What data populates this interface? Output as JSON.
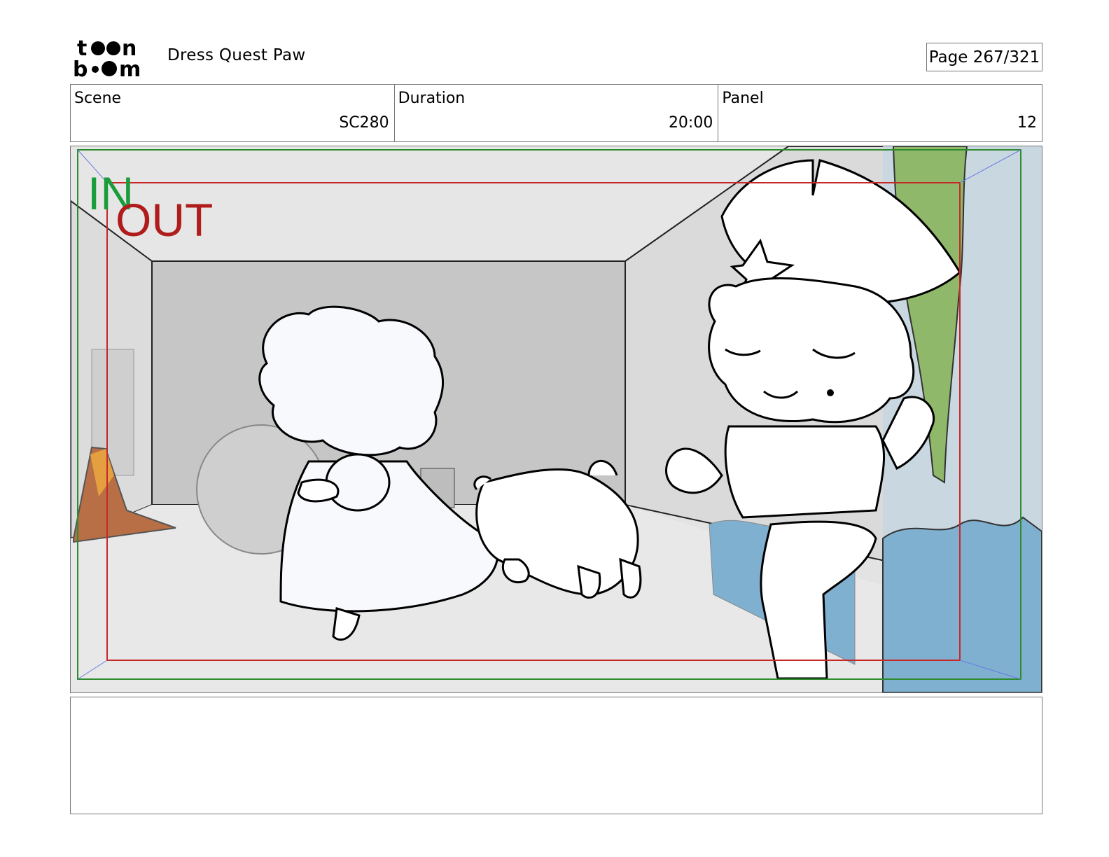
{
  "header": {
    "logo_text": "toon boom",
    "project_title": "Dress Quest Paw",
    "page_label": "Page 267/321"
  },
  "info": {
    "scene_label": "Scene",
    "scene_value": "SC280",
    "duration_label": "Duration",
    "duration_value": "20:00",
    "panel_label": "Panel",
    "panel_value": "12"
  },
  "frame": {
    "in_label": "IN",
    "out_label": "OUT",
    "colors": {
      "in": "#1a9c3a",
      "out": "#b01b1b",
      "safe_frame": "#2e8b2e",
      "camera_frame": "#c62828"
    }
  },
  "notes": {
    "text": ""
  }
}
